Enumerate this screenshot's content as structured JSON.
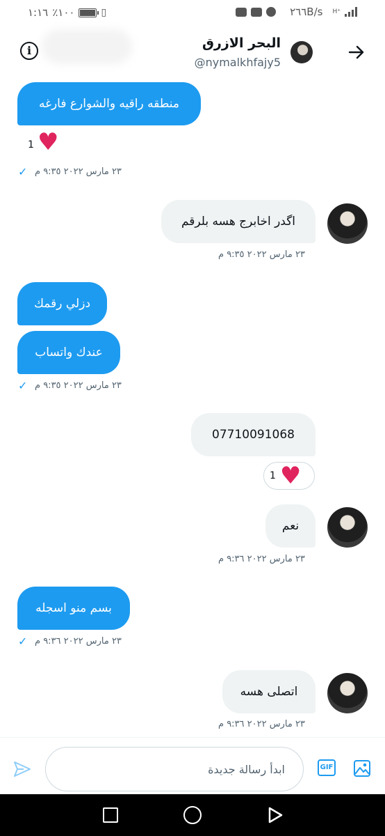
{
  "status_bar": {
    "time": "١:١٦",
    "battery": "٪١٠٠",
    "net_speed": "٢٦٦B/s"
  },
  "header": {
    "name": "البحر الازرق",
    "handle": "@nymalkhfajy5"
  },
  "messages": [
    {
      "text": "منطقه راقيه والشوارع فارغه",
      "reaction_count": "1",
      "timestamp": "٢٣ مارس ٢٠٢٢ ٩:٣٥ م"
    },
    {
      "text": "اگدر اخابرج هسه بلرقم",
      "timestamp": "٢٣ مارس ٢٠٢٢ ٩:٣٥ م"
    },
    {
      "text": "دزلي رقمك"
    },
    {
      "text": "عندك واتساب",
      "timestamp": "٢٣ مارس ٢٠٢٢ ٩:٣٥ م"
    },
    {
      "text": "07710091068",
      "reaction_count": "1"
    },
    {
      "text": "نعم",
      "timestamp": "٢٣ مارس ٢٠٢٢ ٩:٣٦ م"
    },
    {
      "text": "بسم منو اسجله",
      "timestamp": "٢٣ مارس ٢٠٢٢ ٩:٣٦ م"
    },
    {
      "text": "اتصلی هسه",
      "timestamp": "٢٣ مارس ٢٠٢٢ ٩:٣٦ م"
    }
  ],
  "composer": {
    "placeholder": "ابدأ رسالة جديدة",
    "gif_label": "GIF"
  },
  "icons": {
    "info": "info-icon",
    "back": "arrow-right-icon",
    "send": "send-icon",
    "gif": "gif-icon",
    "image": "image-icon",
    "heart": "heart-icon",
    "check": "check-icon"
  },
  "colors": {
    "accent": "#1d9bf0",
    "heart": "#e0245e",
    "received_bubble": "#eff3f4"
  }
}
